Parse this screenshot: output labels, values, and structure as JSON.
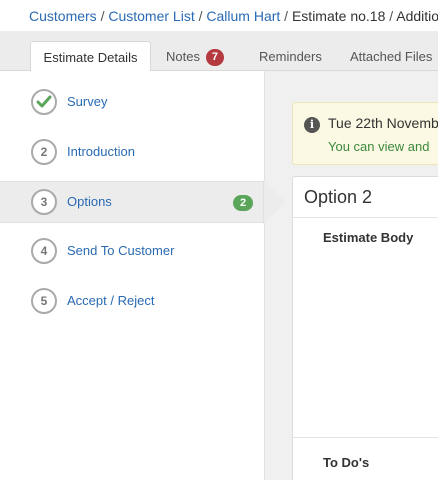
{
  "breadcrumb": {
    "items": [
      {
        "label": "Customers",
        "link": true
      },
      {
        "label": "Customer List",
        "link": true
      },
      {
        "label": "Callum Hart",
        "link": true
      },
      {
        "label": "Estimate no.18",
        "link": false
      },
      {
        "label": "Additio",
        "link": false
      }
    ],
    "separator": " / "
  },
  "tabs": [
    {
      "label": "Estimate Details",
      "active": true
    },
    {
      "label": "Notes",
      "badge": "7"
    },
    {
      "label": "Reminders"
    },
    {
      "label": "Attached Files"
    }
  ],
  "steps": [
    {
      "number": "",
      "label": "Survey",
      "status": "complete",
      "icon": "check-icon"
    },
    {
      "number": "2",
      "label": "Introduction"
    },
    {
      "number": "3",
      "label": "Options",
      "active": true,
      "count": "2"
    },
    {
      "number": "4",
      "label": "Send To Customer"
    },
    {
      "number": "5",
      "label": "Accept / Reject"
    }
  ],
  "alert": {
    "icon": "info-icon",
    "date": "Tue 22th Novemb",
    "message": "You can view and"
  },
  "panel": {
    "title": "Option 2",
    "sections": [
      "Estimate Body",
      "To Do's"
    ]
  },
  "colors": {
    "link": "#2a6ab3",
    "badge_red": "#b53a3f",
    "badge_green": "#5aa55a",
    "check_green": "#5aa55a",
    "alert_bg": "#fbf8e3",
    "alert_text_green": "#3c8a3c"
  }
}
